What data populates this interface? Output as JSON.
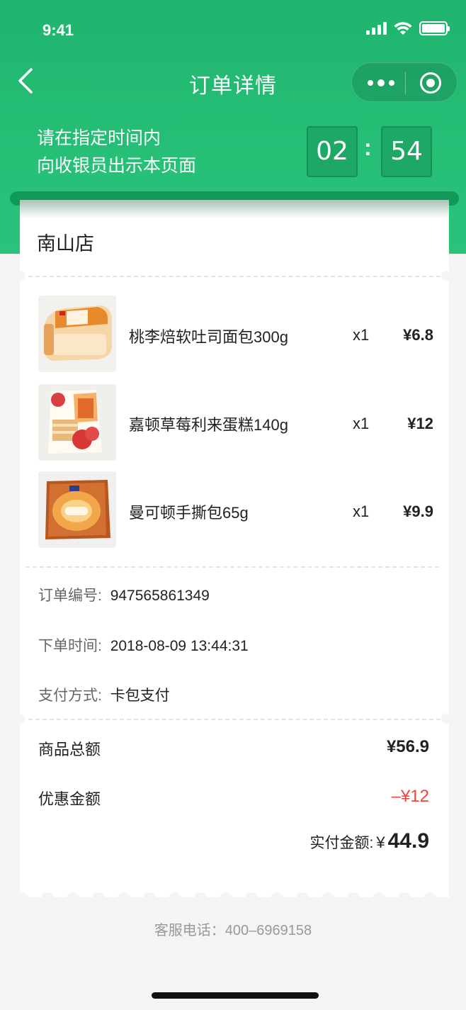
{
  "status_bar": {
    "time": "9:41"
  },
  "nav": {
    "title": "订单详情"
  },
  "tip": {
    "line1": "请在指定时间内",
    "line2": "向收银员出示本页面"
  },
  "timer": {
    "minutes": "02",
    "colon": ":",
    "seconds": "54"
  },
  "store": {
    "name": "南山店"
  },
  "items": [
    {
      "name": "桃李焙软吐司面包300g",
      "qty": "x1",
      "price": "¥6.8"
    },
    {
      "name": "嘉顿草莓利来蛋糕140g",
      "qty": "x1",
      "price": "¥12"
    },
    {
      "name": "曼可顿手撕包65g",
      "qty": "x1",
      "price": "¥9.9"
    }
  ],
  "order_info": {
    "number_label": "订单编号:",
    "number_value": "947565861349",
    "time_label": "下单时间:",
    "time_value": "2018-08-09 13:44:31",
    "pay_label": "支付方式:",
    "pay_value": "卡包支付"
  },
  "summary": {
    "total_label": "商品总额",
    "total_value": "¥56.9",
    "discount_label": "优惠金额",
    "discount_value": "–¥12",
    "paid_label": "实付金额:",
    "paid_currency": "¥",
    "paid_value": "44.9"
  },
  "footer": {
    "service": "客服电话：400–6969158"
  },
  "colors": {
    "primary": "#22b873",
    "discount": "#f0443b"
  },
  "icons": [
    "back-arrow-icon",
    "more-dots-icon",
    "close-circle-icon",
    "signal-icon",
    "wifi-icon",
    "battery-icon"
  ]
}
